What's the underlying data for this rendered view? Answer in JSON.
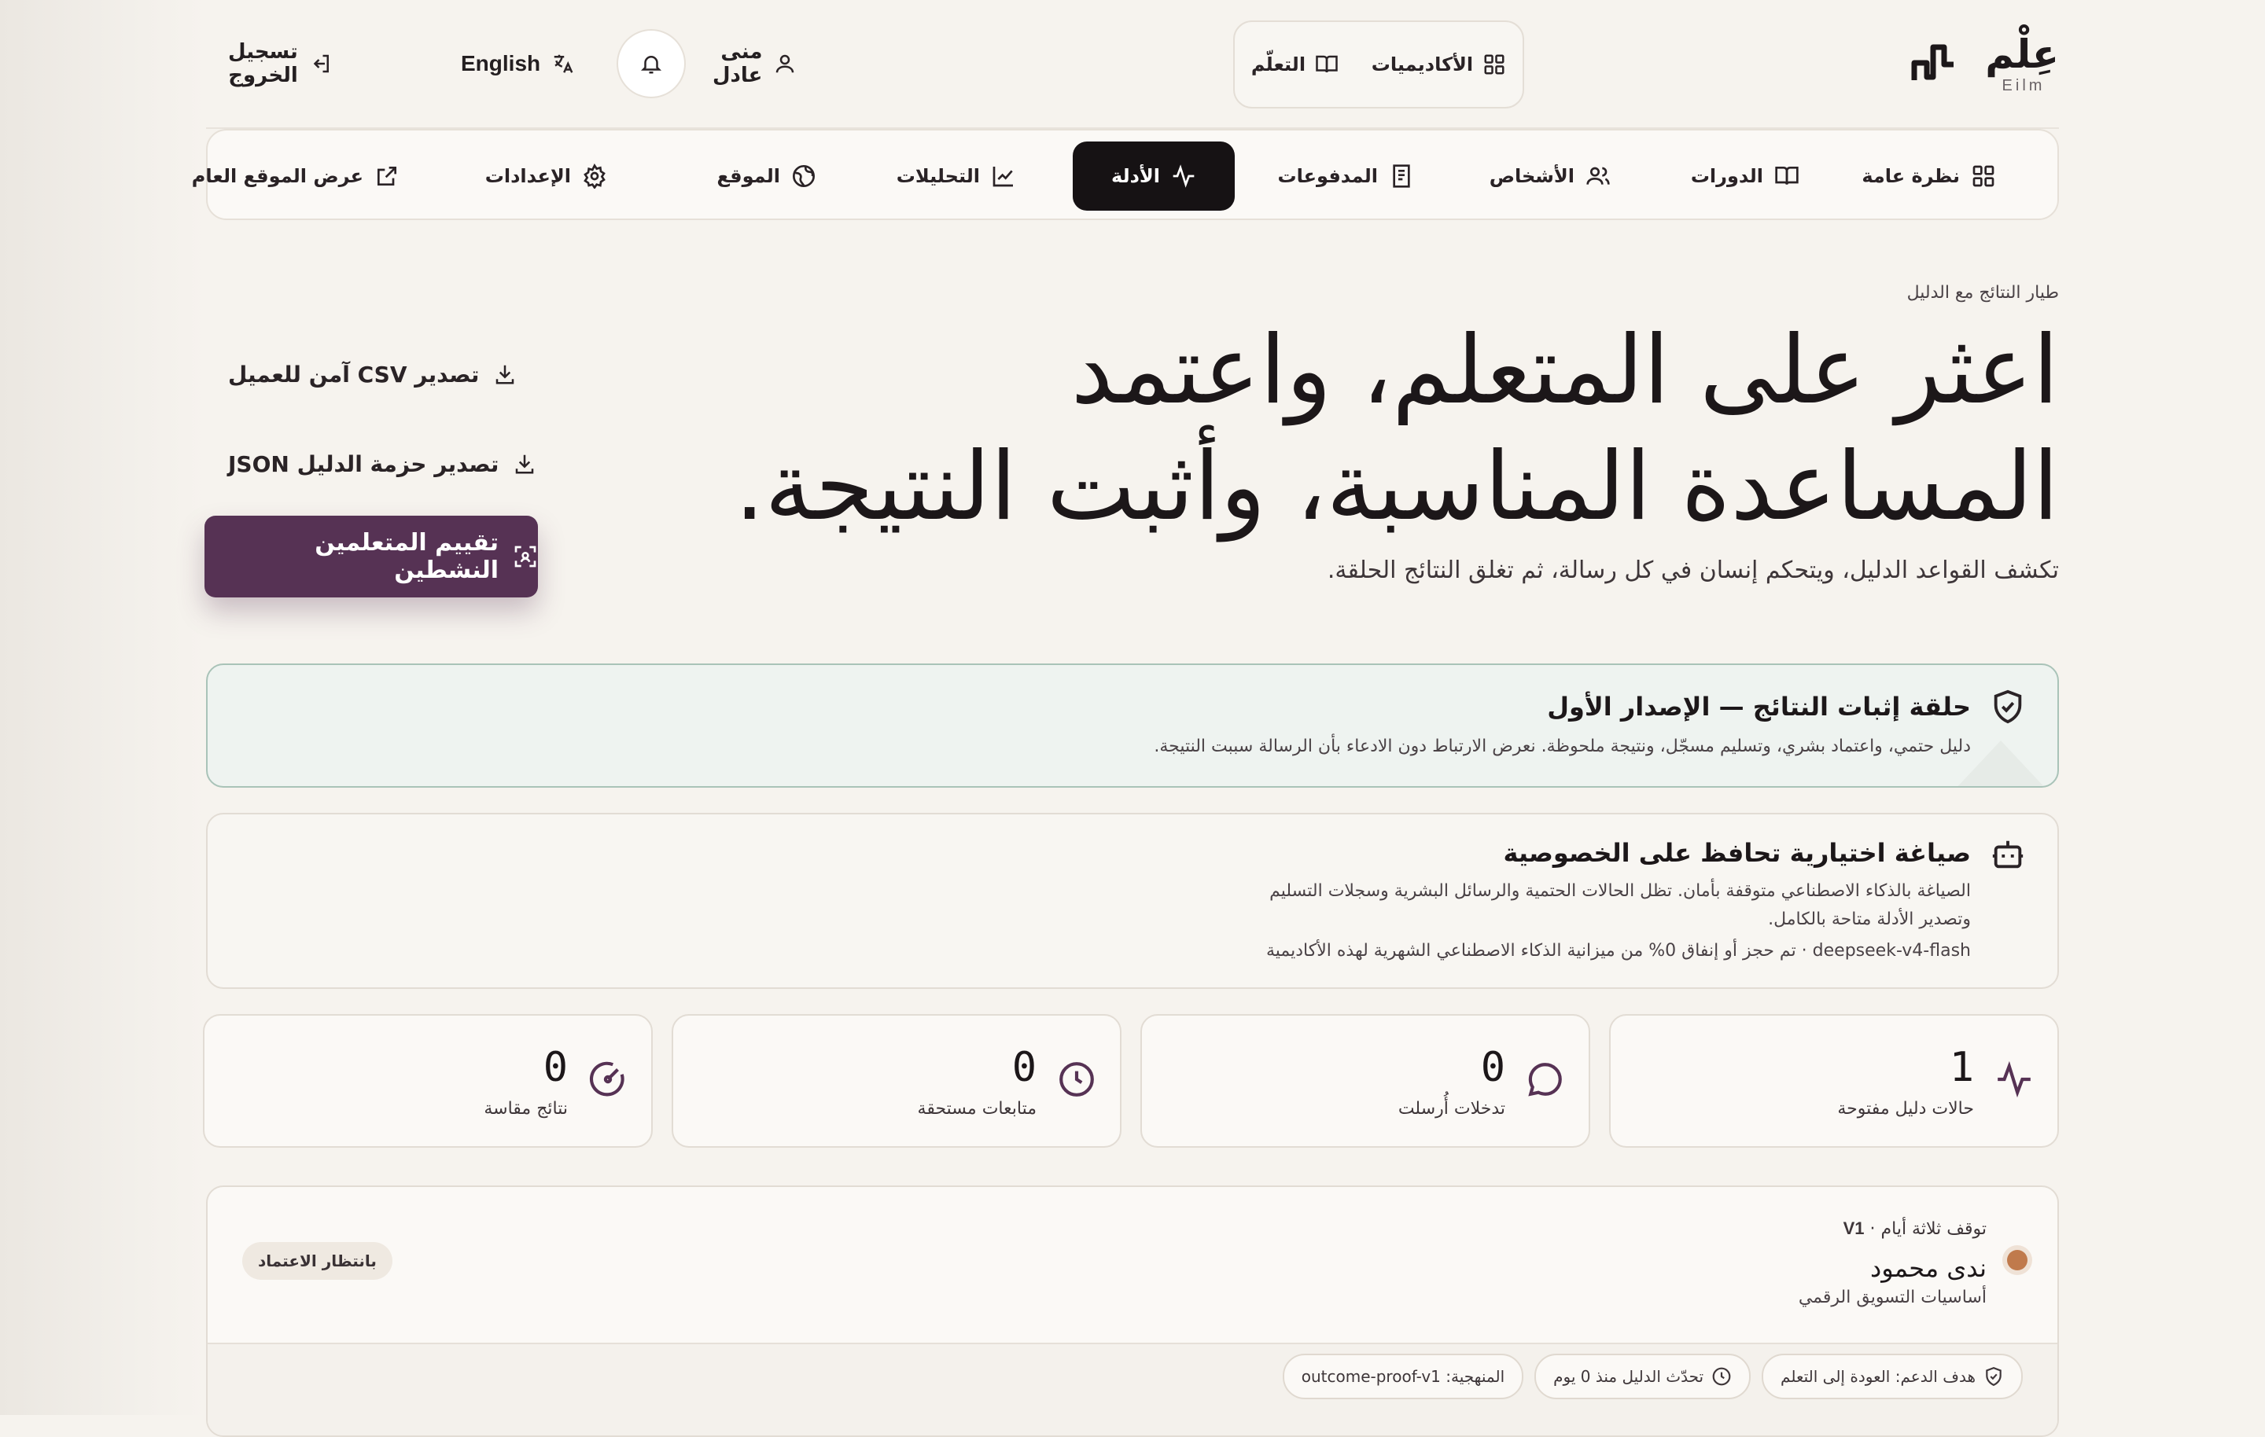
{
  "brand": {
    "name_ar": "عِلْم",
    "name_en": "Eilm"
  },
  "header": {
    "switch": {
      "academies": "الأكاديميات",
      "learning": "التعلّم"
    },
    "user_name": "منى عادل",
    "language": "English",
    "logout": "تسجيل الخروج"
  },
  "nav": {
    "items": [
      {
        "label": "نظرة عامة",
        "icon": "grid-icon"
      },
      {
        "label": "الدورات",
        "icon": "book-icon"
      },
      {
        "label": "الأشخاص",
        "icon": "users-icon"
      },
      {
        "label": "المدفوعات",
        "icon": "receipt-icon"
      },
      {
        "label": "الأدلة",
        "icon": "pulse-icon",
        "active": true
      },
      {
        "label": "التحليلات",
        "icon": "chart-icon"
      },
      {
        "label": "الموقع",
        "icon": "globe-icon"
      },
      {
        "label": "الإعدادات",
        "icon": "gear-icon"
      },
      {
        "label": "عرض الموقع العام",
        "icon": "external-link-icon"
      }
    ]
  },
  "hero": {
    "eyebrow": "طيار النتائج مع الدليل",
    "title_line1": "اعثر على المتعلم، واعتمد",
    "title_line2": "المساعدة المناسبة، وأثبت النتيجة.",
    "subtitle": "تكشف القواعد الدليل، ويتحكم إنسان في كل رسالة، ثم تغلق النتائج الحلقة.",
    "export_csv": "تصدير CSV آمن للعميل",
    "export_json": "تصدير حزمة الدليل JSON",
    "primary": "تقييم المتعلمين النشطين"
  },
  "proof_card": {
    "title": "حلقة إثبات النتائج — الإصدار الأول",
    "text": "دليل حتمي، واعتماد بشري، وتسليم مسجّل، ونتيجة ملحوظة. نعرض الارتباط دون الادعاء بأن الرسالة سببت النتيجة."
  },
  "privacy_card": {
    "title": "صياغة اختيارية تحافظ على الخصوصية",
    "text": "الصياغة بالذكاء الاصطناعي متوقفة بأمان. تظل الحالات الحتمية والرسائل البشرية وسجلات التسليم وتصدير الأدلة متاحة بالكامل.",
    "budget": "deepseek-v4-flash · تم حجز أو إنفاق 0% من ميزانية الذكاء الاصطناعي الشهرية لهذه الأكاديمية"
  },
  "stats": [
    {
      "value": "1",
      "label": "حالات دليل مفتوحة",
      "icon": "pulse-icon"
    },
    {
      "value": "0",
      "label": "تدخلات أُرسلت",
      "icon": "message-icon"
    },
    {
      "value": "0",
      "label": "متابعات مستحقة",
      "icon": "clock-icon"
    },
    {
      "value": "0",
      "label": "نتائج مقاسة",
      "icon": "gauge-icon"
    }
  ],
  "case": {
    "meta_prefix": "توقف ثلاثة أيام ·",
    "meta_version": "V1",
    "learner": "ندى محمود",
    "course": "أساسيات التسويق الرقمي",
    "status": "بانتظار الاعتماد",
    "chips": {
      "goal": "هدف الدعم: العودة إلى التعلم",
      "updated": "تحدّث الدليل منذ 0 يوم",
      "methodology": "المنهجية: outcome-proof-v1"
    }
  },
  "colors": {
    "primary": "#563254",
    "active_nav": "#161214",
    "proof_border": "#a9c3b8",
    "dot": "#c07a4c"
  }
}
